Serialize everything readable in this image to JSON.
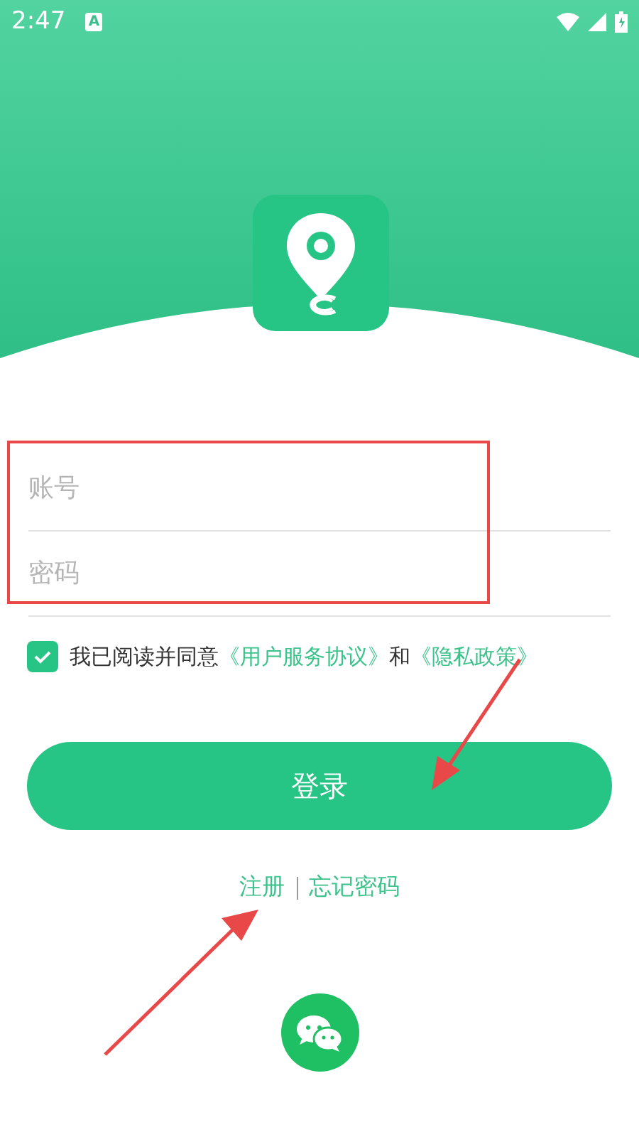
{
  "status_bar": {
    "time": "2:47",
    "notification": "A"
  },
  "login_form": {
    "account": {
      "placeholder": "账号"
    },
    "password": {
      "placeholder": "密码"
    }
  },
  "agreement": {
    "checked": true,
    "text": "我已阅读并同意",
    "links": [
      "《用户服务协议》",
      "《隐私政策》"
    ],
    "conjunction": "和"
  },
  "login_button": "登录",
  "links": [
    "注册",
    "忘记密码"
  ]
}
